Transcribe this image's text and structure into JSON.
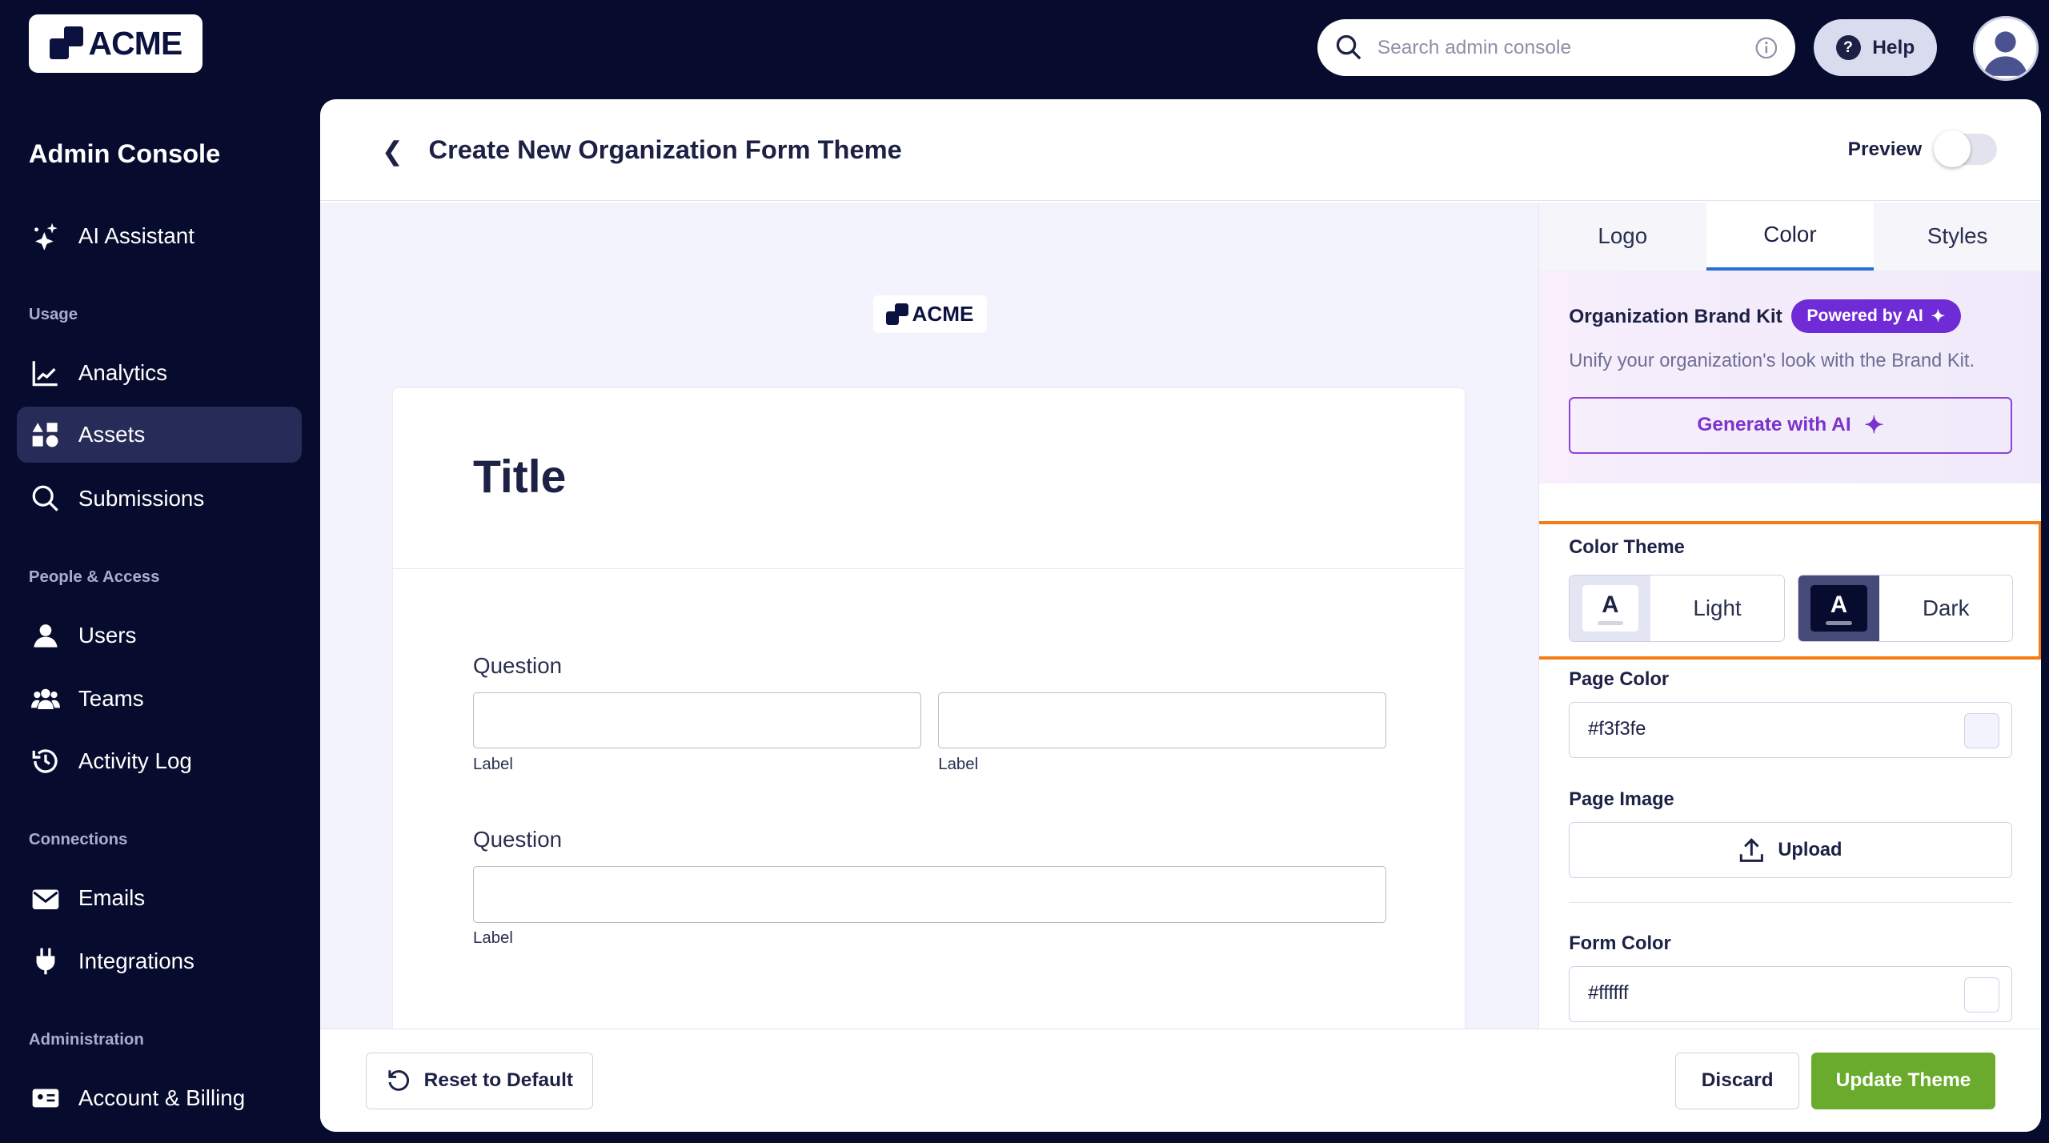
{
  "brand": {
    "logo_text": "ACME"
  },
  "topbar": {
    "search_placeholder": "Search admin console",
    "help_label": "Help"
  },
  "sidebar": {
    "title": "Admin Console",
    "ai_assistant": "AI Assistant",
    "sections": [
      {
        "label": "Usage",
        "items": [
          "Analytics",
          "Assets",
          "Submissions"
        ]
      },
      {
        "label": "People & Access",
        "items": [
          "Users",
          "Teams",
          "Activity Log"
        ]
      },
      {
        "label": "Connections",
        "items": [
          "Emails",
          "Integrations"
        ]
      },
      {
        "label": "Administration",
        "items": [
          "Account & Billing"
        ]
      }
    ],
    "active_item": "Assets"
  },
  "page": {
    "title": "Create New Organization Form Theme",
    "preview_label": "Preview",
    "preview_on": false
  },
  "preview": {
    "logo_text": "ACME",
    "form_title": "Title",
    "question1": "Question",
    "question2": "Question",
    "label": "Label"
  },
  "panel": {
    "tabs": [
      "Logo",
      "Color",
      "Styles"
    ],
    "active_tab": "Color",
    "brand_kit": {
      "heading": "Organization Brand Kit",
      "badge": "Powered by AI",
      "subtitle": "Unify your organization's look with the Brand Kit.",
      "generate_label": "Generate with AI"
    },
    "color_theme": {
      "label": "Color Theme",
      "options": [
        "Light",
        "Dark"
      ],
      "glyph": "A"
    },
    "page_color": {
      "label": "Page Color",
      "value": "#f3f3fe"
    },
    "page_image": {
      "label": "Page Image",
      "upload_label": "Upload"
    },
    "form_color": {
      "label": "Form Color",
      "value": "#ffffff"
    }
  },
  "footer": {
    "reset_label": "Reset to Default",
    "discard_label": "Discard",
    "update_label": "Update Theme"
  },
  "colors": {
    "sidebar_bg": "#070b2e",
    "accent_purple": "#6f2bd6",
    "update_green": "#6aab2e",
    "highlight": "#f57c10",
    "active_tab": "#2b6fd6"
  }
}
